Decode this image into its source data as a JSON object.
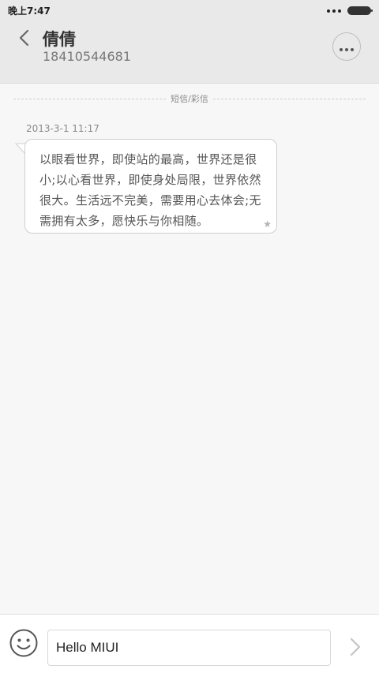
{
  "status_bar": {
    "time": "晚上7:47"
  },
  "header": {
    "contact_name": "倩倩",
    "contact_number": "18410544681",
    "back_icon": "chevron-left-icon",
    "more_icon": "more-horizontal-icon"
  },
  "divider": {
    "label": "短信/彩信"
  },
  "messages": [
    {
      "timestamp": "2013-3-1 11:17",
      "text": "以眼看世界，即使站的最高，世界还是很小;以心看世界，即使身处局限，世界依然很大。生活远不完美，需要用心去体会;无需拥有太多，愿快乐与你相随。",
      "starred": true
    }
  ],
  "compose": {
    "value": "Hello MIUI",
    "emoji_icon": "smiley-icon",
    "send_icon": "chevron-right-icon"
  },
  "colors": {
    "header_bg": "#e9e9e9",
    "page_bg": "#f7f7f7",
    "bubble_bg": "#ffffff",
    "bubble_border": "#cfcfcf"
  }
}
